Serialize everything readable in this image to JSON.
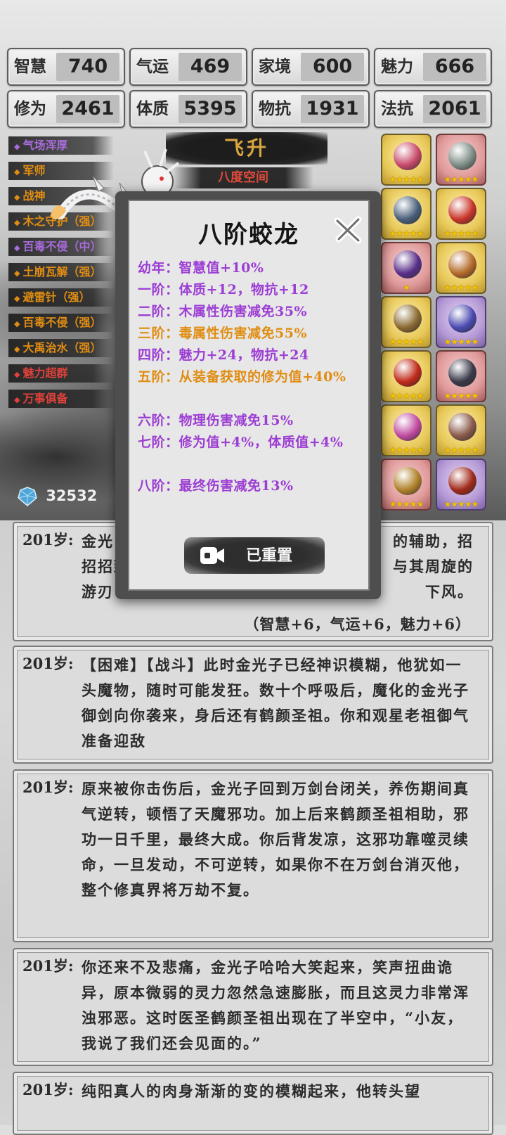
{
  "stats": [
    {
      "label": "智慧",
      "value": "740"
    },
    {
      "label": "气运",
      "value": "469"
    },
    {
      "label": "家境",
      "value": "600"
    },
    {
      "label": "魅力",
      "value": "666"
    },
    {
      "label": "修为",
      "value": "2461"
    },
    {
      "label": "体质",
      "value": "5395"
    },
    {
      "label": "物抗",
      "value": "1931"
    },
    {
      "label": "法抗",
      "value": "2061"
    }
  ],
  "traits": [
    {
      "label": "气场浑厚",
      "color": "#a86bdc"
    },
    {
      "label": "军师",
      "color": "#e08d13"
    },
    {
      "label": "战神",
      "color": "#e08d13"
    },
    {
      "label": "木之守护（强）",
      "color": "#e08d13"
    },
    {
      "label": "百毒不侵（中）",
      "color": "#a86bdc"
    },
    {
      "label": "土崩瓦解（强）",
      "color": "#e08d13"
    },
    {
      "label": "避雷针（强）",
      "color": "#e08d13"
    },
    {
      "label": "百毒不侵（强）",
      "color": "#e08d13"
    },
    {
      "label": "大禹治水（强）",
      "color": "#e08d13"
    },
    {
      "label": "魅力超群",
      "color": "#e0413a"
    },
    {
      "label": "万事俱备",
      "color": "#e0413a"
    }
  ],
  "ascend": {
    "label": "飞升",
    "realm": "八度空间"
  },
  "currency": {
    "icon": "diamond-icon",
    "amount": "32532"
  },
  "items": [
    {
      "name": "crimson-bird-icon",
      "rarity": "gold",
      "stars": "★★★★★",
      "color": "#c84a6a"
    },
    {
      "name": "jade-spade-icon",
      "rarity": "red",
      "stars": "★★★★★",
      "color": "#7e8d86"
    },
    {
      "name": "blue-blade-icon",
      "rarity": "gold",
      "stars": "★★★★★",
      "color": "#4a5f7a"
    },
    {
      "name": "ruby-ring-icon",
      "rarity": "gold",
      "stars": "★★★★★",
      "color": "#c8362a"
    },
    {
      "name": "purple-mirror-icon",
      "rarity": "red",
      "stars": "★",
      "color": "#5a2f8a"
    },
    {
      "name": "golden-cauldron-icon",
      "rarity": "gold",
      "stars": "★★★★★",
      "color": "#b46a2a"
    },
    {
      "name": "golden-key-icon",
      "rarity": "gold",
      "stars": "★★★★★",
      "color": "#8a6a32"
    },
    {
      "name": "sapphire-ring-icon",
      "rarity": "purple",
      "stars": "★★★★★",
      "color": "#4a4ab0"
    },
    {
      "name": "red-orb-icon",
      "rarity": "gold",
      "stars": "★★★★★",
      "color": "#c02a1a"
    },
    {
      "name": "dark-sword-icon",
      "rarity": "red",
      "stars": "★★★★★",
      "color": "#3a3a4a"
    },
    {
      "name": "pink-teapot-icon",
      "rarity": "gold",
      "stars": "★★★★★",
      "color": "#c04aa0"
    },
    {
      "name": "scroll-icon",
      "rarity": "gold",
      "stars": "★★★★★",
      "color": "#8a5a4a"
    },
    {
      "name": "golden-sword-icon",
      "rarity": "red",
      "stars": "★★★★★",
      "color": "#b0822a"
    },
    {
      "name": "flame-spear-icon",
      "rarity": "purple",
      "stars": "★★★★★",
      "color": "#a02a1a"
    }
  ],
  "modal": {
    "title": "八阶蛟龙",
    "tiers": [
      {
        "text": "幼年：智慧值+10%",
        "color": "purple"
      },
      {
        "text": "一阶：体质+12，物抗+12",
        "color": "purple"
      },
      {
        "text": "二阶：木属性伤害减免35%",
        "color": "purple"
      },
      {
        "text": "三阶：毒属性伤害减免55%",
        "color": "orange"
      },
      {
        "text": "四阶：魅力+24，物抗+24",
        "color": "purple"
      },
      {
        "text": "五阶：从装备获取的修为值+40%",
        "color": "orange"
      },
      {
        "text": "六阶：物理伤害减免15%",
        "color": "purple"
      },
      {
        "text": "七阶：修为值+4%，体质值+4%",
        "color": "purple"
      },
      {
        "text": "八阶：最终伤害减免13%",
        "color": "purple"
      }
    ],
    "button_label": "已重置"
  },
  "log": [
    {
      "age": "201岁:",
      "text": "金光子也会用剑阵辅助他，招招致命，剑阵的剑刃与其周旋的游刃有余，却也难掩下风。",
      "partial_left": "金光",
      "partial_left2": "招招致",
      "partial_left3": "游刃",
      "partial_right": "的辅助，招",
      "partial_right2": "与其周旋的",
      "partial_right3": "下风。",
      "result": "（智慧+6，气运+6，魅力+6）"
    },
    {
      "age": "201岁:",
      "text": "【困难】【战斗】此时金光子已经神识模糊，他犹如一头魔物，随时可能发狂。数十个呼吸后，魔化的金光子御剑向你袭来，身后还有鹤颜圣祖。你和观星老祖御气准备迎敌"
    },
    {
      "age": "201岁:",
      "text": "原来被你击伤后，金光子回到万剑台闭关，养伤期间真气逆转，顿悟了天魔邪功。加上后来鹤颜圣祖相助，邪功一日千里，最终大成。你后背发凉，这邪功靠噬灵续命，一旦发动，不可逆转，如果你不在万剑台消灭他，整个修真界将万劫不复。"
    },
    {
      "age": "201岁:",
      "text": "你还来不及悲痛，金光子哈哈大笑起来，笑声扭曲诡异，原本微弱的灵力忽然急速膨胀，而且这灵力非常浑浊邪恶。这时医圣鹤颜圣祖出现在了半空中，“小友，我说了我们还会见面的。”"
    },
    {
      "age": "201岁:",
      "text": "纯阳真人的肉身渐渐的变的模糊起来，他转头望"
    }
  ]
}
